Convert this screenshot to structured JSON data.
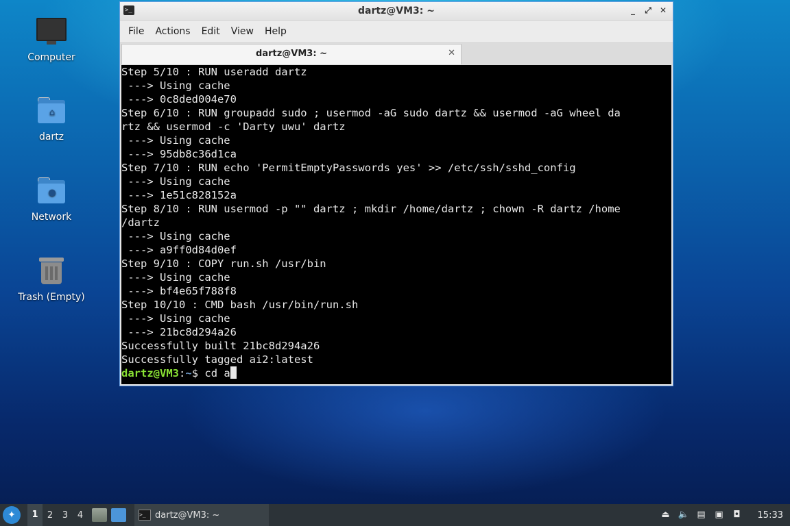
{
  "desktop": {
    "icons": [
      {
        "label": "Computer",
        "icon": "computer-icon"
      },
      {
        "label": "dartz",
        "icon": "home-folder-icon"
      },
      {
        "label": "Network",
        "icon": "network-folder-icon"
      },
      {
        "label": "Trash (Empty)",
        "icon": "trash-icon"
      }
    ]
  },
  "window": {
    "title": "dartz@VM3: ~",
    "controls": {
      "minimize": "_",
      "maximize": "⤢",
      "close": "✕"
    },
    "menu": [
      "File",
      "Actions",
      "Edit",
      "View",
      "Help"
    ],
    "tab_label": "dartz@VM3: ~",
    "tab_close": "✕"
  },
  "terminal": {
    "lines": [
      "Step 5/10 : RUN useradd dartz",
      " ---> Using cache",
      " ---> 0c8ded004e70",
      "Step 6/10 : RUN groupadd sudo ; usermod -aG sudo dartz && usermod -aG wheel da",
      "rtz && usermod -c 'Darty uwu' dartz",
      " ---> Using cache",
      " ---> 95db8c36d1ca",
      "Step 7/10 : RUN echo 'PermitEmptyPasswords yes' >> /etc/ssh/sshd_config",
      " ---> Using cache",
      " ---> 1e51c828152a",
      "Step 8/10 : RUN usermod -p \"\" dartz ; mkdir /home/dartz ; chown -R dartz /home",
      "/dartz",
      " ---> Using cache",
      " ---> a9ff0d84d0ef",
      "Step 9/10 : COPY run.sh /usr/bin",
      " ---> Using cache",
      " ---> bf4e65f788f8",
      "Step 10/10 : CMD bash /usr/bin/run.sh",
      " ---> Using cache",
      " ---> 21bc8d294a26",
      "Successfully built 21bc8d294a26",
      "Successfully tagged ai2:latest"
    ],
    "prompt_user": "dartz@VM3",
    "prompt_sep": ":",
    "prompt_path": "~",
    "prompt_symbol": "$ ",
    "command": "cd a"
  },
  "taskbar": {
    "workspaces": [
      "1",
      "2",
      "3",
      "4"
    ],
    "active_workspace": "1",
    "task_label": "dartz@VM3: ~",
    "clock": "15:33"
  }
}
